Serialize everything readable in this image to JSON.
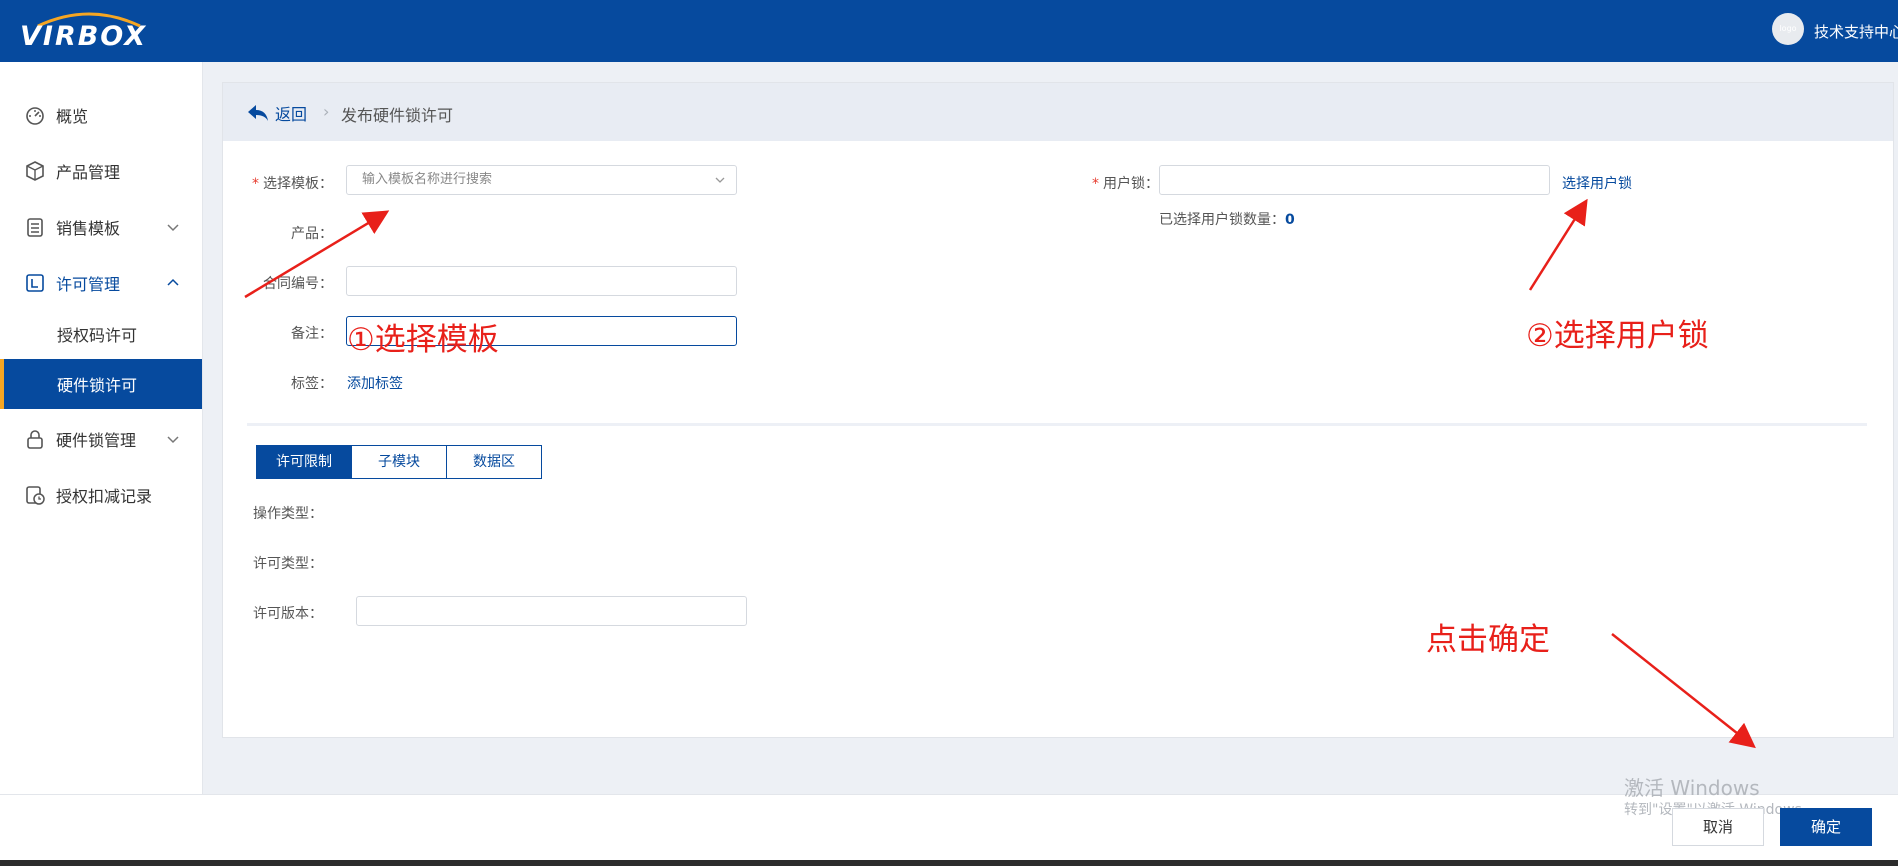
{
  "header": {
    "logo_text": "VIRBOX",
    "avatar_text": "logo",
    "user_name": "技术支持中心"
  },
  "sidebar": {
    "items": [
      {
        "label": "概览",
        "icon": "dashboard-icon"
      },
      {
        "label": "产品管理",
        "icon": "cube-icon"
      },
      {
        "label": "销售模板",
        "icon": "clipboard-icon"
      },
      {
        "label": "许可管理",
        "icon": "license-icon"
      },
      {
        "label": "授权码许可"
      },
      {
        "label": "硬件锁许可"
      },
      {
        "label": "硬件锁管理",
        "icon": "lock-icon"
      },
      {
        "label": "授权扣减记录",
        "icon": "record-icon"
      }
    ]
  },
  "breadcrumb": {
    "back_label": "返回",
    "separator": "›",
    "current": "发布硬件锁许可"
  },
  "form": {
    "required_mark": "*",
    "template_label": "选择模板：",
    "template_placeholder": "输入模板名称进行搜索",
    "product_label": "产品：",
    "contract_label": "合同编号：",
    "remark_label": "备注：",
    "tag_label": "标签：",
    "add_tag_link": "添加标签",
    "user_lock_label": "用户锁：",
    "select_user_lock_link": "选择用户锁",
    "selected_count_label": "已选择用户锁数量：",
    "selected_count_value": "0"
  },
  "tabs": [
    {
      "label": "许可限制",
      "active": true
    },
    {
      "label": "子模块",
      "active": false
    },
    {
      "label": "数据区",
      "active": false
    }
  ],
  "license": {
    "op_type_label": "操作类型：",
    "license_type_label": "许可类型：",
    "version_label": "许可版本："
  },
  "footer": {
    "cancel_label": "取消",
    "ok_label": "确定"
  },
  "watermark": {
    "line1": "激活 Windows",
    "line2": "转到\"设置\"以激活 Windows。"
  },
  "annotations": {
    "step1": "①选择模板",
    "step2": "②选择用户锁",
    "step3": "点击确定",
    "color": "#e8201a"
  },
  "colors": {
    "brand": "#064a9e",
    "accent": "#f5a623"
  }
}
